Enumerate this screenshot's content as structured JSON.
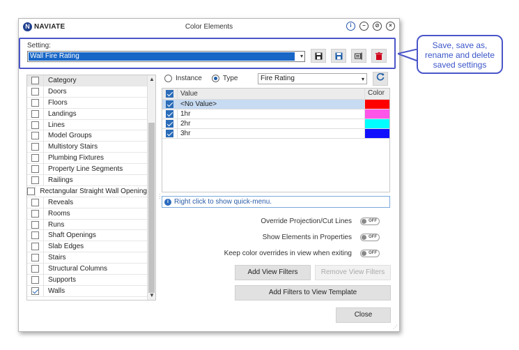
{
  "window": {
    "logo_text": "NAVIATE",
    "title": "Color Elements"
  },
  "setting": {
    "label": "Setting:",
    "value": "Wall Fire Rating"
  },
  "categories": {
    "header": "Category",
    "items": [
      {
        "label": "Doors",
        "checked": false
      },
      {
        "label": "Floors",
        "checked": false
      },
      {
        "label": "Landings",
        "checked": false
      },
      {
        "label": "Lines",
        "checked": false
      },
      {
        "label": "Model Groups",
        "checked": false
      },
      {
        "label": "Multistory Stairs",
        "checked": false
      },
      {
        "label": "Plumbing Fixtures",
        "checked": false
      },
      {
        "label": "Property Line Segments",
        "checked": false
      },
      {
        "label": "Railings",
        "checked": false
      },
      {
        "label": "Rectangular Straight Wall Opening",
        "checked": false
      },
      {
        "label": "Reveals",
        "checked": false
      },
      {
        "label": "Rooms",
        "checked": false
      },
      {
        "label": "Runs",
        "checked": false
      },
      {
        "label": "Shaft Openings",
        "checked": false
      },
      {
        "label": "Slab Edges",
        "checked": false
      },
      {
        "label": "Stairs",
        "checked": false
      },
      {
        "label": "Structural Columns",
        "checked": false
      },
      {
        "label": "Supports",
        "checked": false
      },
      {
        "label": "Walls",
        "checked": true
      }
    ]
  },
  "mode": {
    "instance_label": "Instance",
    "type_label": "Type",
    "selected": "Type",
    "parameter": "Fire Rating"
  },
  "values_table": {
    "col_value": "Value",
    "col_color": "Color",
    "rows": [
      {
        "value": "<No Value>",
        "color": "#ff0000",
        "checked": true
      },
      {
        "value": "1hr",
        "color": "#ff55e8",
        "checked": true
      },
      {
        "value": "2hr",
        "color": "#00ffff",
        "checked": true
      },
      {
        "value": "3hr",
        "color": "#1010ff",
        "checked": true
      }
    ]
  },
  "info": {
    "text": "Right click to show quick-menu."
  },
  "toggles": [
    {
      "label": "Override Projection/Cut Lines",
      "state": "OFF"
    },
    {
      "label": "Show Elements in Properties",
      "state": "OFF"
    },
    {
      "label": "Keep color overrides in view when exiting",
      "state": "OFF"
    }
  ],
  "buttons": {
    "add_view_filters": "Add View Filters",
    "remove_view_filters": "Remove View Filters",
    "add_filters_template": "Add Filters to View Template",
    "close": "Close"
  },
  "callout": {
    "text": "Save, save as, rename and delete saved settings"
  },
  "colors": {
    "accent": "#4a55c8",
    "selection": "#1866c6"
  }
}
